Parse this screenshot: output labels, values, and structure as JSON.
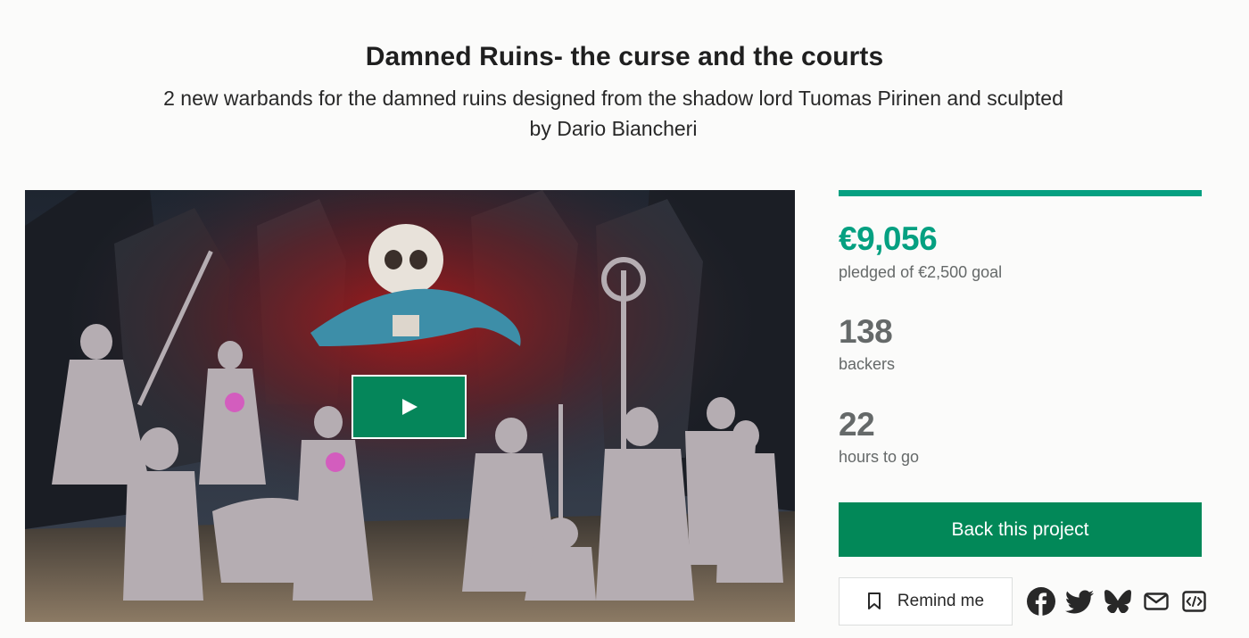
{
  "project": {
    "title": "Damned Ruins- the curse and the courts",
    "subtitle": "2 new warbands for the damned ruins designed from the shadow lord Tuomas Pirinen and sculpted by Dario Biancheri"
  },
  "media": {
    "play_icon": "play-icon"
  },
  "stats": {
    "progress_fraction": 1.0,
    "pledged_amount": "€9,056",
    "pledged_label": "pledged of €2,500 goal",
    "backers_count": "138",
    "backers_label": "backers",
    "time_remaining": "22",
    "time_label": "hours to go"
  },
  "actions": {
    "back_label": "Back this project",
    "remind_label": "Remind me",
    "remind_icon": "bookmark-icon"
  },
  "share": {
    "icons": [
      "facebook-icon",
      "twitter-icon",
      "bluesky-icon",
      "email-icon",
      "embed-icon"
    ]
  },
  "colors": {
    "accent": "#05a081",
    "button": "#028858",
    "muted_text": "#656969"
  }
}
